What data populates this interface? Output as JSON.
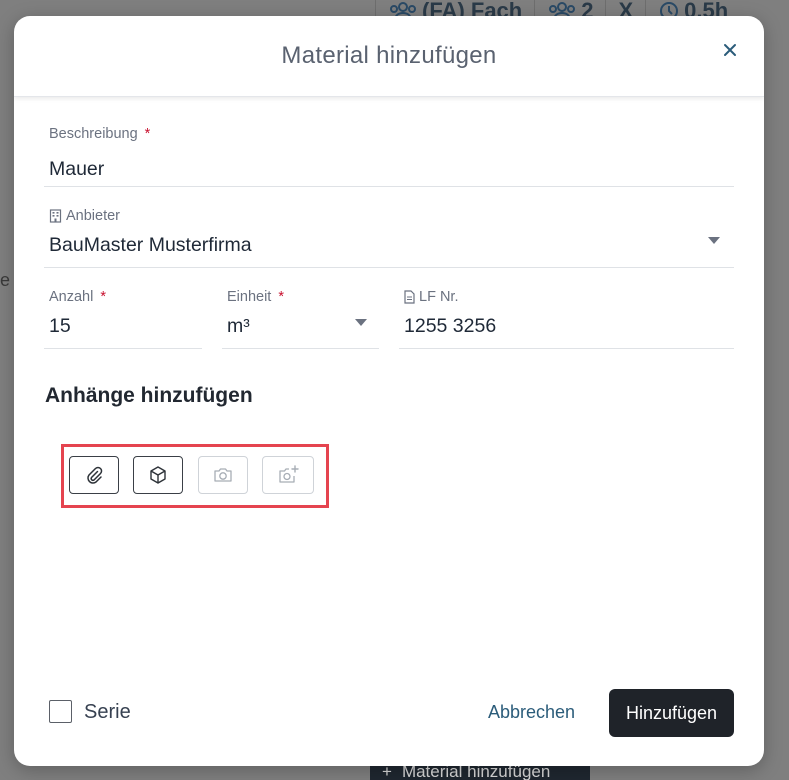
{
  "background": {
    "topbar": {
      "chip1_label": "(FA) Fach",
      "chip2_label": "2",
      "chip3_label": "X",
      "chip4_label": "0,5h"
    },
    "left_letter": "e",
    "bottom_button_label": "Material hinzufügen"
  },
  "modal": {
    "title": "Material hinzufügen",
    "fields": {
      "beschreibung": {
        "label": "Beschreibung",
        "required": "*",
        "value": "Mauer"
      },
      "anbieter": {
        "label": "Anbieter",
        "value": "BauMaster Musterfirma"
      },
      "anzahl": {
        "label": "Anzahl",
        "required": "*",
        "value": "15"
      },
      "einheit": {
        "label": "Einheit",
        "required": "*",
        "value": "m³"
      },
      "lf_nr": {
        "label": "LF Nr.",
        "value": "1255 3256"
      }
    },
    "attachments_title": "Anhänge hinzufügen",
    "attachment_buttons": [
      {
        "icon": "paperclip-icon",
        "enabled": true
      },
      {
        "icon": "cube-icon",
        "enabled": true
      },
      {
        "icon": "camera-icon",
        "enabled": false
      },
      {
        "icon": "add-photo-icon",
        "enabled": false
      }
    ],
    "footer": {
      "series_label": "Serie",
      "cancel_label": "Abbrechen",
      "submit_label": "Hinzufügen"
    }
  },
  "colors": {
    "primary_button": "#1f2329",
    "required_star": "#c8102e",
    "highlight_border": "#e5444f",
    "link": "#2b5c7a"
  }
}
